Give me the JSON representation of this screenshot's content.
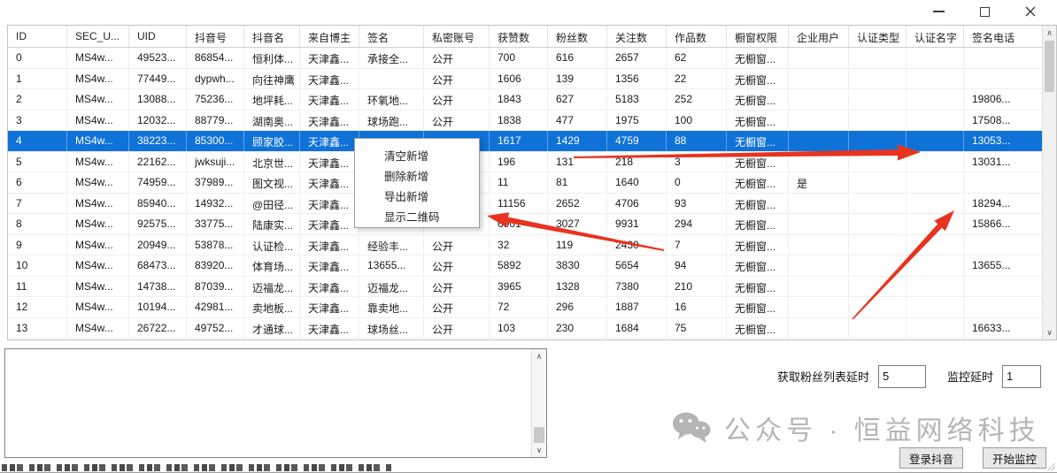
{
  "titlebar": {
    "icons": {
      "minimize": "minimize-bar",
      "maximize": "square-outline",
      "close": "x-cross"
    }
  },
  "table": {
    "columns": [
      "ID",
      "SEC_U...",
      "UID",
      "抖音号",
      "抖音名",
      "来自博主",
      "签名",
      "私密账号",
      "获赞数",
      "粉丝数",
      "关注数",
      "作品数",
      "橱窗权限",
      "企业用户",
      "认证类型",
      "认证名字",
      "签名电话"
    ],
    "rows": [
      [
        "0",
        "MS4w...",
        "49523...",
        "86854...",
        "恒利体...",
        "天津鑫...",
        "承接全...",
        "公开",
        "700",
        "616",
        "2657",
        "62",
        "无橱窗...",
        "",
        "",
        "",
        ""
      ],
      [
        "1",
        "MS4w...",
        "77449...",
        "dypwh...",
        "向往神鹰",
        "天津鑫...",
        "",
        "公开",
        "1606",
        "139",
        "1356",
        "22",
        "无橱窗...",
        "",
        "",
        "",
        ""
      ],
      [
        "2",
        "MS4w...",
        "13088...",
        "75236...",
        "地坪耗...",
        "天津鑫...",
        "环氧地...",
        "公开",
        "1843",
        "627",
        "5183",
        "252",
        "无橱窗...",
        "",
        "",
        "",
        "19806..."
      ],
      [
        "3",
        "MS4w...",
        "12032...",
        "88779...",
        "湖南奥...",
        "天津鑫...",
        "球场跑...",
        "公开",
        "1838",
        "477",
        "1975",
        "100",
        "无橱窗...",
        "",
        "",
        "",
        "17508..."
      ],
      [
        "4",
        "MS4w...",
        "38223...",
        "85300...",
        "顾家胶...",
        "天津鑫...",
        "",
        "",
        "1617",
        "1429",
        "4759",
        "88",
        "无橱窗...",
        "",
        "",
        "",
        "13053..."
      ],
      [
        "5",
        "MS4w...",
        "22162...",
        "jwksuji...",
        "北京世...",
        "天津鑫...",
        "",
        "",
        "196",
        "131",
        "218",
        "3",
        "无橱窗...",
        "",
        "",
        "",
        "13031..."
      ],
      [
        "6",
        "MS4w...",
        "74959...",
        "37989...",
        "图文视...",
        "天津鑫...",
        "",
        "",
        "11",
        "81",
        "1640",
        "0",
        "无橱窗...",
        "是",
        "",
        "",
        ""
      ],
      [
        "7",
        "MS4w...",
        "85940...",
        "14932...",
        "@田径...",
        "天津鑫...",
        "",
        "",
        "11156",
        "2652",
        "4706",
        "93",
        "无橱窗...",
        "",
        "",
        "",
        "18294..."
      ],
      [
        "8",
        "MS4w...",
        "92575...",
        "33775...",
        "陆康实...",
        "天津鑫...",
        "",
        "",
        "6901",
        "3027",
        "9931",
        "294",
        "无橱窗...",
        "",
        "",
        "",
        "15866..."
      ],
      [
        "9",
        "MS4w...",
        "20949...",
        "53878...",
        "认证检...",
        "天津鑫...",
        "经验丰...",
        "公开",
        "32",
        "119",
        "2430",
        "7",
        "无橱窗...",
        "",
        "",
        "",
        ""
      ],
      [
        "10",
        "MS4w...",
        "68473...",
        "83920...",
        "体育场...",
        "天津鑫...",
        "13655...",
        "公开",
        "5892",
        "3830",
        "5654",
        "94",
        "无橱窗...",
        "",
        "",
        "",
        "13655..."
      ],
      [
        "11",
        "MS4w...",
        "14738...",
        "87039...",
        "迈福龙...",
        "天津鑫...",
        "迈福龙...",
        "公开",
        "3965",
        "1328",
        "7380",
        "210",
        "无橱窗...",
        "",
        "",
        "",
        ""
      ],
      [
        "12",
        "MS4w...",
        "10194...",
        "42981...",
        "卖地板...",
        "天津鑫...",
        "靠卖地...",
        "公开",
        "72",
        "296",
        "1887",
        "16",
        "无橱窗...",
        "",
        "",
        "",
        ""
      ],
      [
        "13",
        "MS4w...",
        "26722...",
        "49752...",
        "才通球...",
        "天津鑫...",
        "球场丝...",
        "公开",
        "103",
        "230",
        "1684",
        "75",
        "无橱窗...",
        "",
        "",
        "",
        "16633..."
      ]
    ],
    "selected_row_index": 4,
    "scrollbar": {
      "up": "∧",
      "down": "∨"
    }
  },
  "context_menu": {
    "items": [
      "清空新增",
      "删除新增",
      "导出新增",
      "显示二维码"
    ]
  },
  "log_panel": {
    "content": "",
    "scrollbar": {
      "up": "∧",
      "down": "∨"
    }
  },
  "settings": {
    "fans_delay_label": "获取粉丝列表延时",
    "fans_delay_value": "5",
    "monitor_delay_label": "监控延时",
    "monitor_delay_value": "1"
  },
  "watermark": {
    "icon": "wechat-bubbles",
    "text": "公众号 · 恒益网络科技"
  },
  "buttons": {
    "login": "登录抖音",
    "monitor": "开始监控"
  },
  "colors": {
    "selection_blue": "#0f72d8",
    "annotation_red": "#e8331f",
    "watermark_gray": "#b5b5b5"
  }
}
